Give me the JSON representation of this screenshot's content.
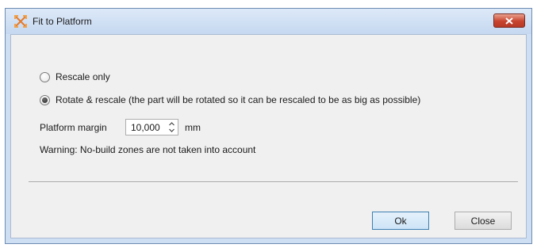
{
  "window": {
    "title": "Fit to Platform"
  },
  "options": {
    "rescale_only_label": "Rescale only",
    "rotate_rescale_label": "Rotate & rescale (the part will be rotated so it can be rescaled to be as big as possible)",
    "selected": "rotate_rescale"
  },
  "platform_margin": {
    "label": "Platform margin",
    "value": "10,000",
    "unit": "mm"
  },
  "warning": "Warning: No-build zones are not taken into account",
  "buttons": {
    "ok_label": "Ok",
    "close_label": "Close"
  },
  "icons": {
    "app_icon": "fit-to-platform-icon",
    "close_icon": "close-x-icon",
    "spin_up_icon": "chevron-up-icon",
    "spin_down_icon": "chevron-down-icon"
  },
  "colors": {
    "titlebar": "#cfdff3",
    "close_button": "#c8442e",
    "ok_button_border": "#3c7fb1",
    "dialog_background": "#f0f0f0"
  }
}
